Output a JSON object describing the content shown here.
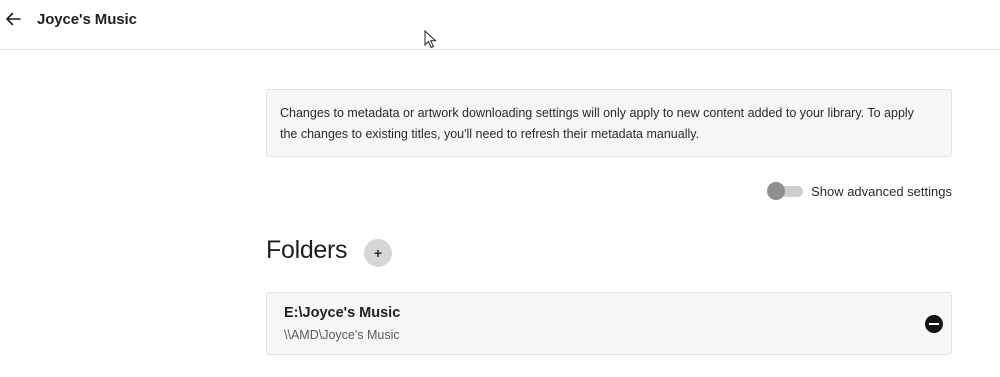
{
  "header": {
    "title": "Joyce's Music",
    "back_icon": "arrow-left-icon"
  },
  "notice": {
    "line1": "Changes to metadata or artwork downloading settings will only apply to new content added to your library. To apply",
    "line2": "the changes to existing titles, you'll need to refresh their metadata manually."
  },
  "advanced": {
    "label": "Show advanced settings",
    "enabled": false
  },
  "folders": {
    "heading": "Folders",
    "add_label": "+",
    "items": [
      {
        "name": "E:\\Joyce's Music",
        "path": "\\\\AMD\\Joyce's Music"
      }
    ]
  }
}
